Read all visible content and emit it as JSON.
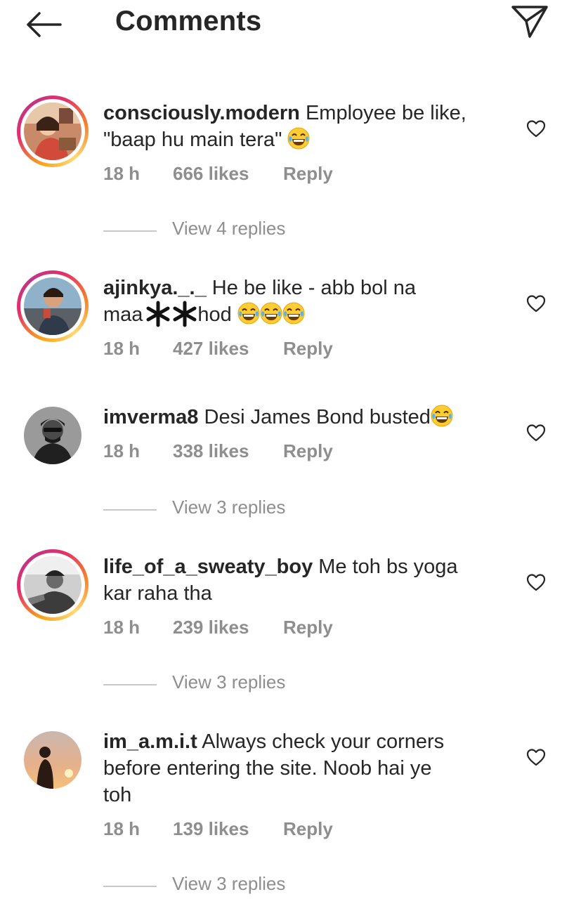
{
  "header": {
    "title": "Comments",
    "back_icon": "arrow-left-icon",
    "share_icon": "paper-plane-icon"
  },
  "comments": [
    {
      "username": "consciously.modern",
      "text_1": "Employee be like,",
      "text_2": "\"baap hu main tera\"",
      "time": "18 h",
      "likes": "666 likes",
      "reply": "Reply",
      "view_replies": "View 4 replies"
    },
    {
      "username": "ajinkya._._",
      "text_1": "He be like - abb bol na",
      "text_2": "maa",
      "text_3": "hod",
      "time": "18 h",
      "likes": "427 likes",
      "reply": "Reply"
    },
    {
      "username": "imverma8",
      "text_1": "Desi James Bond busted",
      "time": "18 h",
      "likes": "338 likes",
      "reply": "Reply",
      "view_replies": "View 3 replies"
    },
    {
      "username": "life_of_a_sweaty_boy",
      "text_1": "Me toh bs yoga",
      "text_2": "kar raha tha",
      "time": "18 h",
      "likes": "239 likes",
      "reply": "Reply",
      "view_replies": "View 3 replies"
    },
    {
      "username": "im_a.m.i.t",
      "text_1": "Always check your corners",
      "text_2": "before entering the site. Noob hai ye",
      "text_3": "toh",
      "time": "18 h",
      "likes": "139 likes",
      "reply": "Reply",
      "view_replies": "View 3 replies"
    }
  ],
  "icons": {
    "like": "heart-outline-icon",
    "emoji": "face-with-tears-of-joy-emoji"
  },
  "colors": {
    "text": "#262626",
    "secondary": "#8e8e8e",
    "story_ring_start": "#f58529",
    "story_ring_end": "#c13584"
  }
}
